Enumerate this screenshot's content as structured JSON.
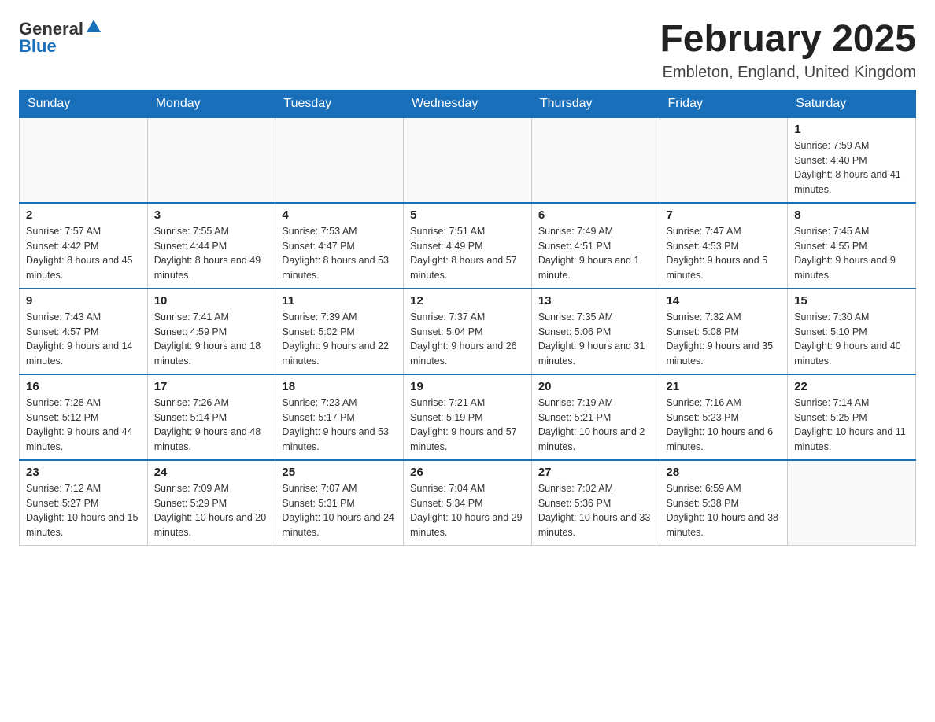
{
  "logo": {
    "text_general": "General",
    "text_blue": "Blue"
  },
  "title": {
    "month_year": "February 2025",
    "location": "Embleton, England, United Kingdom"
  },
  "days_of_week": [
    "Sunday",
    "Monday",
    "Tuesday",
    "Wednesday",
    "Thursday",
    "Friday",
    "Saturday"
  ],
  "weeks": [
    {
      "days": [
        {
          "num": "",
          "info": ""
        },
        {
          "num": "",
          "info": ""
        },
        {
          "num": "",
          "info": ""
        },
        {
          "num": "",
          "info": ""
        },
        {
          "num": "",
          "info": ""
        },
        {
          "num": "",
          "info": ""
        },
        {
          "num": "1",
          "info": "Sunrise: 7:59 AM\nSunset: 4:40 PM\nDaylight: 8 hours and 41 minutes."
        }
      ]
    },
    {
      "days": [
        {
          "num": "2",
          "info": "Sunrise: 7:57 AM\nSunset: 4:42 PM\nDaylight: 8 hours and 45 minutes."
        },
        {
          "num": "3",
          "info": "Sunrise: 7:55 AM\nSunset: 4:44 PM\nDaylight: 8 hours and 49 minutes."
        },
        {
          "num": "4",
          "info": "Sunrise: 7:53 AM\nSunset: 4:47 PM\nDaylight: 8 hours and 53 minutes."
        },
        {
          "num": "5",
          "info": "Sunrise: 7:51 AM\nSunset: 4:49 PM\nDaylight: 8 hours and 57 minutes."
        },
        {
          "num": "6",
          "info": "Sunrise: 7:49 AM\nSunset: 4:51 PM\nDaylight: 9 hours and 1 minute."
        },
        {
          "num": "7",
          "info": "Sunrise: 7:47 AM\nSunset: 4:53 PM\nDaylight: 9 hours and 5 minutes."
        },
        {
          "num": "8",
          "info": "Sunrise: 7:45 AM\nSunset: 4:55 PM\nDaylight: 9 hours and 9 minutes."
        }
      ]
    },
    {
      "days": [
        {
          "num": "9",
          "info": "Sunrise: 7:43 AM\nSunset: 4:57 PM\nDaylight: 9 hours and 14 minutes."
        },
        {
          "num": "10",
          "info": "Sunrise: 7:41 AM\nSunset: 4:59 PM\nDaylight: 9 hours and 18 minutes."
        },
        {
          "num": "11",
          "info": "Sunrise: 7:39 AM\nSunset: 5:02 PM\nDaylight: 9 hours and 22 minutes."
        },
        {
          "num": "12",
          "info": "Sunrise: 7:37 AM\nSunset: 5:04 PM\nDaylight: 9 hours and 26 minutes."
        },
        {
          "num": "13",
          "info": "Sunrise: 7:35 AM\nSunset: 5:06 PM\nDaylight: 9 hours and 31 minutes."
        },
        {
          "num": "14",
          "info": "Sunrise: 7:32 AM\nSunset: 5:08 PM\nDaylight: 9 hours and 35 minutes."
        },
        {
          "num": "15",
          "info": "Sunrise: 7:30 AM\nSunset: 5:10 PM\nDaylight: 9 hours and 40 minutes."
        }
      ]
    },
    {
      "days": [
        {
          "num": "16",
          "info": "Sunrise: 7:28 AM\nSunset: 5:12 PM\nDaylight: 9 hours and 44 minutes."
        },
        {
          "num": "17",
          "info": "Sunrise: 7:26 AM\nSunset: 5:14 PM\nDaylight: 9 hours and 48 minutes."
        },
        {
          "num": "18",
          "info": "Sunrise: 7:23 AM\nSunset: 5:17 PM\nDaylight: 9 hours and 53 minutes."
        },
        {
          "num": "19",
          "info": "Sunrise: 7:21 AM\nSunset: 5:19 PM\nDaylight: 9 hours and 57 minutes."
        },
        {
          "num": "20",
          "info": "Sunrise: 7:19 AM\nSunset: 5:21 PM\nDaylight: 10 hours and 2 minutes."
        },
        {
          "num": "21",
          "info": "Sunrise: 7:16 AM\nSunset: 5:23 PM\nDaylight: 10 hours and 6 minutes."
        },
        {
          "num": "22",
          "info": "Sunrise: 7:14 AM\nSunset: 5:25 PM\nDaylight: 10 hours and 11 minutes."
        }
      ]
    },
    {
      "days": [
        {
          "num": "23",
          "info": "Sunrise: 7:12 AM\nSunset: 5:27 PM\nDaylight: 10 hours and 15 minutes."
        },
        {
          "num": "24",
          "info": "Sunrise: 7:09 AM\nSunset: 5:29 PM\nDaylight: 10 hours and 20 minutes."
        },
        {
          "num": "25",
          "info": "Sunrise: 7:07 AM\nSunset: 5:31 PM\nDaylight: 10 hours and 24 minutes."
        },
        {
          "num": "26",
          "info": "Sunrise: 7:04 AM\nSunset: 5:34 PM\nDaylight: 10 hours and 29 minutes."
        },
        {
          "num": "27",
          "info": "Sunrise: 7:02 AM\nSunset: 5:36 PM\nDaylight: 10 hours and 33 minutes."
        },
        {
          "num": "28",
          "info": "Sunrise: 6:59 AM\nSunset: 5:38 PM\nDaylight: 10 hours and 38 minutes."
        },
        {
          "num": "",
          "info": ""
        }
      ]
    }
  ]
}
